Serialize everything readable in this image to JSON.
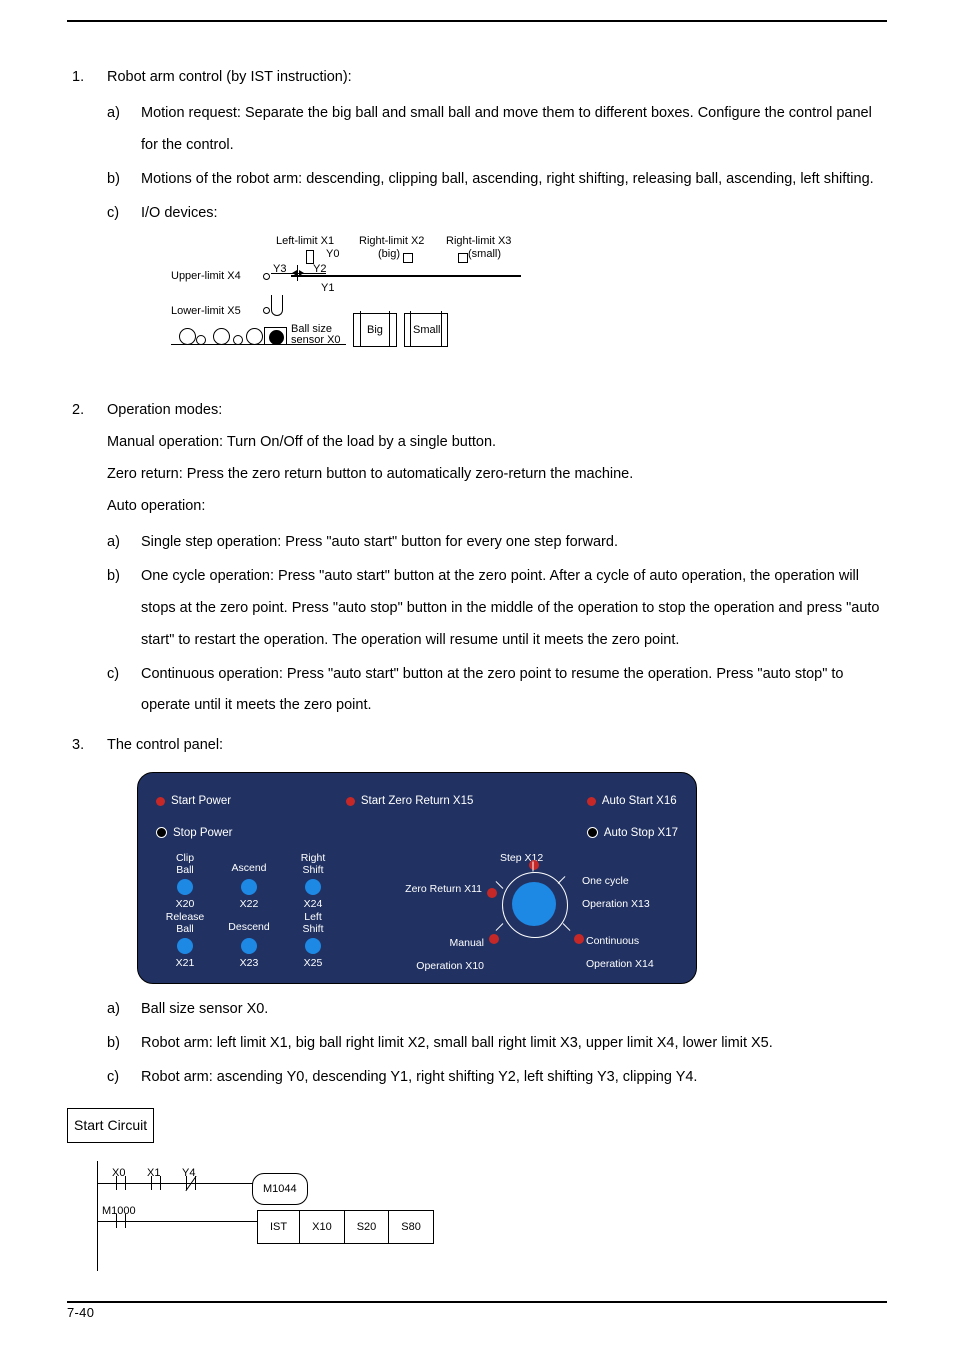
{
  "numbered": {
    "item1": {
      "num": "1.",
      "lead": "Robot arm control (by IST instruction):",
      "a": "Motion request: Separate the big ball and small ball and move them to different boxes. Configure the control panel for the control.",
      "b": "Motions of the robot arm: descending, clipping ball, ascending, right shifting, releasing ball, ascending, left shifting.",
      "c": "I/O devices:"
    },
    "item2": {
      "num": "2.",
      "lead": "Operation modes:",
      "p1": "Manual operation: Turn On/Off of the load by a single button.",
      "p2": "Zero return: Press the zero return button to automatically zero-return the machine.",
      "p3": "Auto operation:",
      "a": "Single step operation: Press \"auto start\" button for every one step forward.",
      "b": "One cycle operation: Press \"auto start\" button at the zero point. After a cycle of auto operation, the operation will stops at the zero point. Press \"auto stop\" button in the middle of the operation to stop the operation and press \"auto start\" to restart the operation. The operation will resume until it meets the zero point.",
      "c": "Continuous operation: Press \"auto start\" button at the zero point to resume the operation. Press \"auto stop\" to operate until it meets the zero point."
    },
    "item3": {
      "num": "3.",
      "lead": "The control panel:",
      "a": "Ball size sensor X0.",
      "b": "Robot arm: left limit X1, big ball right limit X2, small ball right limit X3, upper limit X4, lower limit X5.",
      "c": "Robot arm: ascending Y0, descending Y1, right shifting Y2, left shifting Y3, clipping Y4."
    }
  },
  "letters": {
    "a": "a)",
    "b": "b)",
    "c": "c)"
  },
  "diagram1": {
    "left_limit": "Left-limit X1",
    "right_limit_big": "Right-limit X2",
    "right_limit_small": "Right-limit X3",
    "big": "(big)",
    "small": "(small)",
    "upper_limit": "Upper-limit X4",
    "lower_limit": "Lower-limit X5",
    "ball_size": "Ball size",
    "sensor": "sensor X0",
    "y0": "Y0",
    "y1": "Y1",
    "y2": "Y2",
    "y3": "Y3",
    "big_box": "Big",
    "small_box": "Small"
  },
  "panel": {
    "start_power": "Start Power",
    "stop_power": "Stop Power",
    "start_zero": "Start Zero Return X15",
    "auto_start": "Auto Start X16",
    "auto_stop": "Auto Stop X17",
    "clip_ball": "Clip\nBall",
    "ascend": "Ascend",
    "right_shift": "Right\nShift",
    "x20": "X20",
    "x22": "X22",
    "x24": "X24",
    "release_ball": "Release\nBall",
    "descend": "Descend",
    "left_shift": "Left\nShift",
    "x21": "X21",
    "x23": "X23",
    "x25": "X25",
    "step": "Step X12",
    "zero_return": "Zero Return X11",
    "one_cycle": "One cycle\nOperation X13",
    "manual": "Manual\nOperation X10",
    "continuous": "Continuous\nOperation X14"
  },
  "start_circuit": "Start Circuit",
  "ladder": {
    "x0": "X0",
    "x1": "X1",
    "y4": "Y4",
    "m1000": "M1000",
    "m1044": "M1044",
    "ist": "IST",
    "d1": "X10",
    "d2": "S20",
    "d3": "S80"
  },
  "footer": {
    "page": "7-40"
  }
}
